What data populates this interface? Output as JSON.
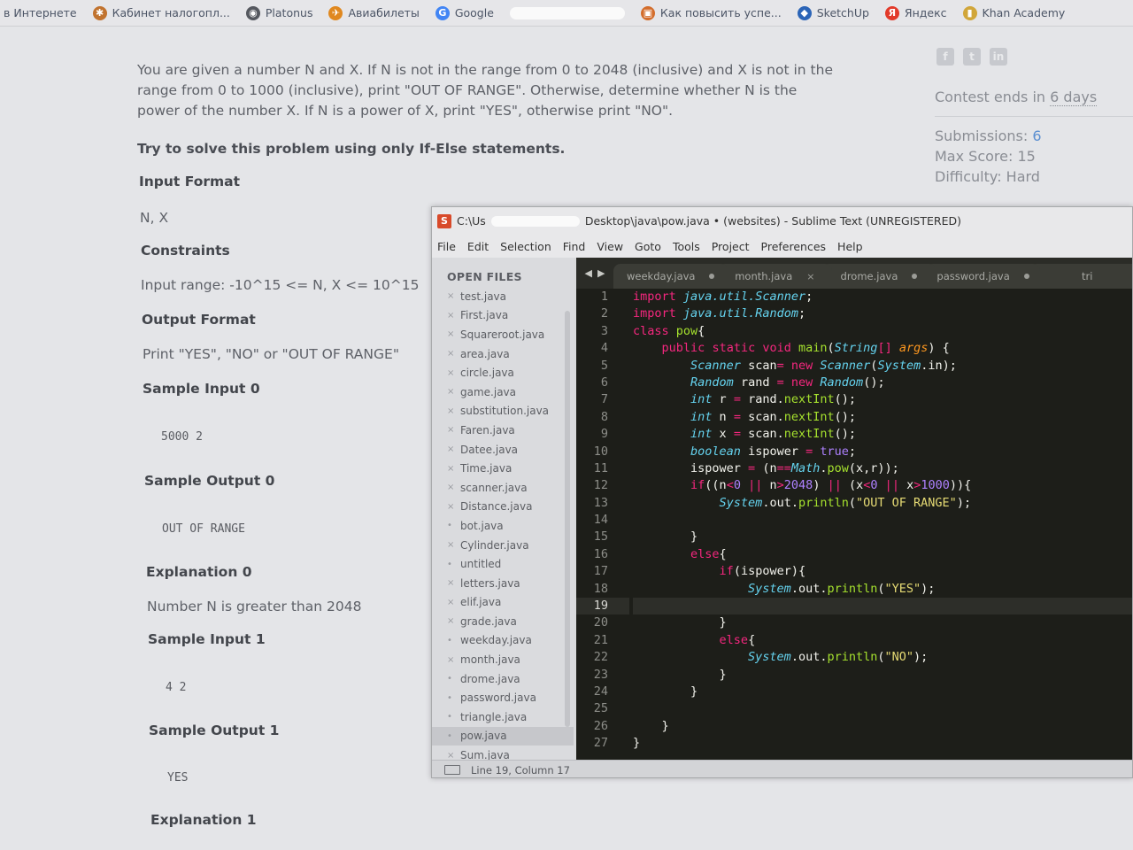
{
  "bookmarks": [
    {
      "label": "в Интернете",
      "icon": "none"
    },
    {
      "label": "Кабинет налогопл...",
      "icon": "gear-icon",
      "color": "#c1732f"
    },
    {
      "label": "Platonus",
      "icon": "globe-icon",
      "color": "#55585f"
    },
    {
      "label": "Авиабилеты",
      "icon": "plane-icon",
      "color": "#e0881f"
    },
    {
      "label": "Google",
      "icon": "google-icon",
      "color": "#4285f4"
    },
    {
      "label": "Как повысить успе...",
      "icon": "picture-icon",
      "color": "#d36d2c"
    },
    {
      "label": "SketchUp",
      "icon": "sketchup-icon",
      "color": "#2b64b7"
    },
    {
      "label": "Яндекс",
      "icon": "yandex-icon",
      "color": "#e23a2a"
    },
    {
      "label": "Khan Academy",
      "icon": "bookmark-icon",
      "color": "#d1a63a"
    }
  ],
  "problem": {
    "description": "You are given a number N and X. If N is not in the range from 0 to 2048 (inclusive) and X is not in the range from 0 to 1000 (inclusive), print \"OUT OF RANGE\". Otherwise, determine whether N is the power of the number X. If N is a power of X, print \"YES\", otherwise print \"NO\".",
    "hint": "Try to solve this problem using only If-Else statements.",
    "input_format_title": "Input Format",
    "input_format": "N, X",
    "constraints_title": "Constraints",
    "constraints": "Input range: -10^15 <= N, X <= 10^15",
    "output_format_title": "Output Format",
    "output_format": "Print \"YES\", \"NO\" or \"OUT OF RANGE\"",
    "sample_input_0_title": "Sample Input 0",
    "sample_input_0": "5000 2",
    "sample_output_0_title": "Sample Output 0",
    "sample_output_0": "OUT OF RANGE",
    "explanation_0_title": "Explanation 0",
    "explanation_0": "Number N is greater than 2048",
    "sample_input_1_title": "Sample Input 1",
    "sample_input_1": "4 2",
    "sample_output_1_title": "Sample Output 1",
    "sample_output_1": "YES",
    "explanation_1_title": "Explanation 1"
  },
  "sidebar_info": {
    "contest_prefix": "Contest ends in ",
    "contest_days": "6 days",
    "submissions_label": "Submissions: ",
    "submissions_value": "6",
    "max_score": "Max Score: 15",
    "difficulty": "Difficulty: Hard",
    "social": [
      "f",
      "t",
      "in"
    ]
  },
  "sublime": {
    "title_start": "C:\\Us",
    "title_end": "Desktop\\java\\pow.java • (websites) - Sublime Text (UNREGISTERED)",
    "menu": [
      "File",
      "Edit",
      "Selection",
      "Find",
      "View",
      "Goto",
      "Tools",
      "Project",
      "Preferences",
      "Help"
    ],
    "open_files_title": "OPEN FILES",
    "files": [
      {
        "name": "test.java",
        "mark": "×"
      },
      {
        "name": "First.java",
        "mark": "×"
      },
      {
        "name": "Squareroot.java",
        "mark": "×"
      },
      {
        "name": "area.java",
        "mark": "×"
      },
      {
        "name": "circle.java",
        "mark": "×"
      },
      {
        "name": "game.java",
        "mark": "×"
      },
      {
        "name": "substitution.java",
        "mark": "×"
      },
      {
        "name": "Faren.java",
        "mark": "×"
      },
      {
        "name": "Datee.java",
        "mark": "×"
      },
      {
        "name": "Time.java",
        "mark": "×"
      },
      {
        "name": "scanner.java",
        "mark": "×"
      },
      {
        "name": "Distance.java",
        "mark": "×"
      },
      {
        "name": "bot.java",
        "mark": "•"
      },
      {
        "name": "Cylinder.java",
        "mark": "×"
      },
      {
        "name": "untitled",
        "mark": "•"
      },
      {
        "name": "letters.java",
        "mark": "×"
      },
      {
        "name": "elif.java",
        "mark": "×"
      },
      {
        "name": "grade.java",
        "mark": "×"
      },
      {
        "name": "weekday.java",
        "mark": "•"
      },
      {
        "name": "month.java",
        "mark": "×"
      },
      {
        "name": "drome.java",
        "mark": "•"
      },
      {
        "name": "password.java",
        "mark": "•"
      },
      {
        "name": "triangle.java",
        "mark": "•"
      },
      {
        "name": "pow.java",
        "mark": "•"
      },
      {
        "name": "Sum.java",
        "mark": "×"
      }
    ],
    "active_file_index": 23,
    "tabs": [
      {
        "label": "weekday.java",
        "state": "dot"
      },
      {
        "label": "month.java",
        "state": "close"
      },
      {
        "label": "drome.java",
        "state": "dot"
      },
      {
        "label": "password.java",
        "state": "dot"
      },
      {
        "label": "tri",
        "state": "none"
      }
    ],
    "current_line": 19,
    "status": "Line 19, Column 17"
  },
  "code_lines": [
    "import java.util.Scanner;",
    "import java.util.Random;",
    "class pow{",
    "    public static void main(String[] args) {",
    "        Scanner scan= new Scanner(System.in);",
    "        Random rand = new Random();",
    "        int r = rand.nextInt();",
    "        int n = scan.nextInt();",
    "        int x = scan.nextInt();",
    "        boolean ispower = true;",
    "        ispower = (n==Math.pow(x,r));",
    "        if((n<0 || n>2048) || (x<0 || x>1000)){",
    "            System.out.println(\"OUT OF RANGE\");",
    "",
    "        }",
    "        else{",
    "            if(ispower){",
    "                System.out.println(\"YES\");",
    "",
    "            }",
    "            else{",
    "                System.out.println(\"NO\");",
    "            }",
    "        }",
    "",
    "    }",
    "}"
  ],
  "colors": {
    "keyword": "#f6277f",
    "type": "#65d3ef",
    "function": "#a6e22e",
    "string": "#e6db74",
    "literal": "#ae81ff",
    "param": "#fd971f",
    "editor_bg": "#1d1e19"
  }
}
